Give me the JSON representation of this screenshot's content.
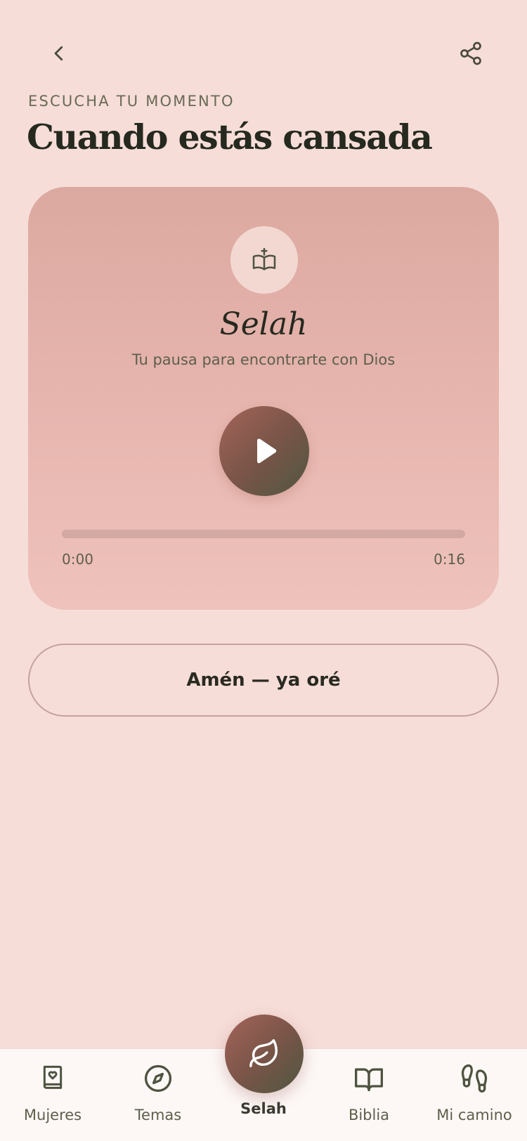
{
  "header": {
    "eyebrow": "ESCUCHA TU MOMENTO",
    "title": "Cuando estás cansada"
  },
  "player": {
    "title": "Selah",
    "subtitle": "Tu pausa para encontrarte con Dios",
    "current_time": "0:00",
    "total_time": "0:16",
    "progress": 0,
    "icon": "bible-icon"
  },
  "actions": {
    "amen_label": "Amén — ya oré"
  },
  "nav": {
    "items": [
      {
        "label": "Mujeres",
        "icon": "book-heart-icon"
      },
      {
        "label": "Temas",
        "icon": "compass-icon"
      },
      {
        "label": "Selah",
        "icon": "leaf-icon",
        "active": true
      },
      {
        "label": "Biblia",
        "icon": "open-book-icon"
      },
      {
        "label": "Mi camino",
        "icon": "footprints-icon"
      }
    ]
  },
  "colors": {
    "background": "#f6ddd8",
    "card_gradient_top": "#dca9a0",
    "card_gradient_bottom": "#efc2bc",
    "accent_gradient_start": "#a5645a",
    "accent_gradient_end": "#4f5640",
    "text_dark": "#25291f"
  }
}
